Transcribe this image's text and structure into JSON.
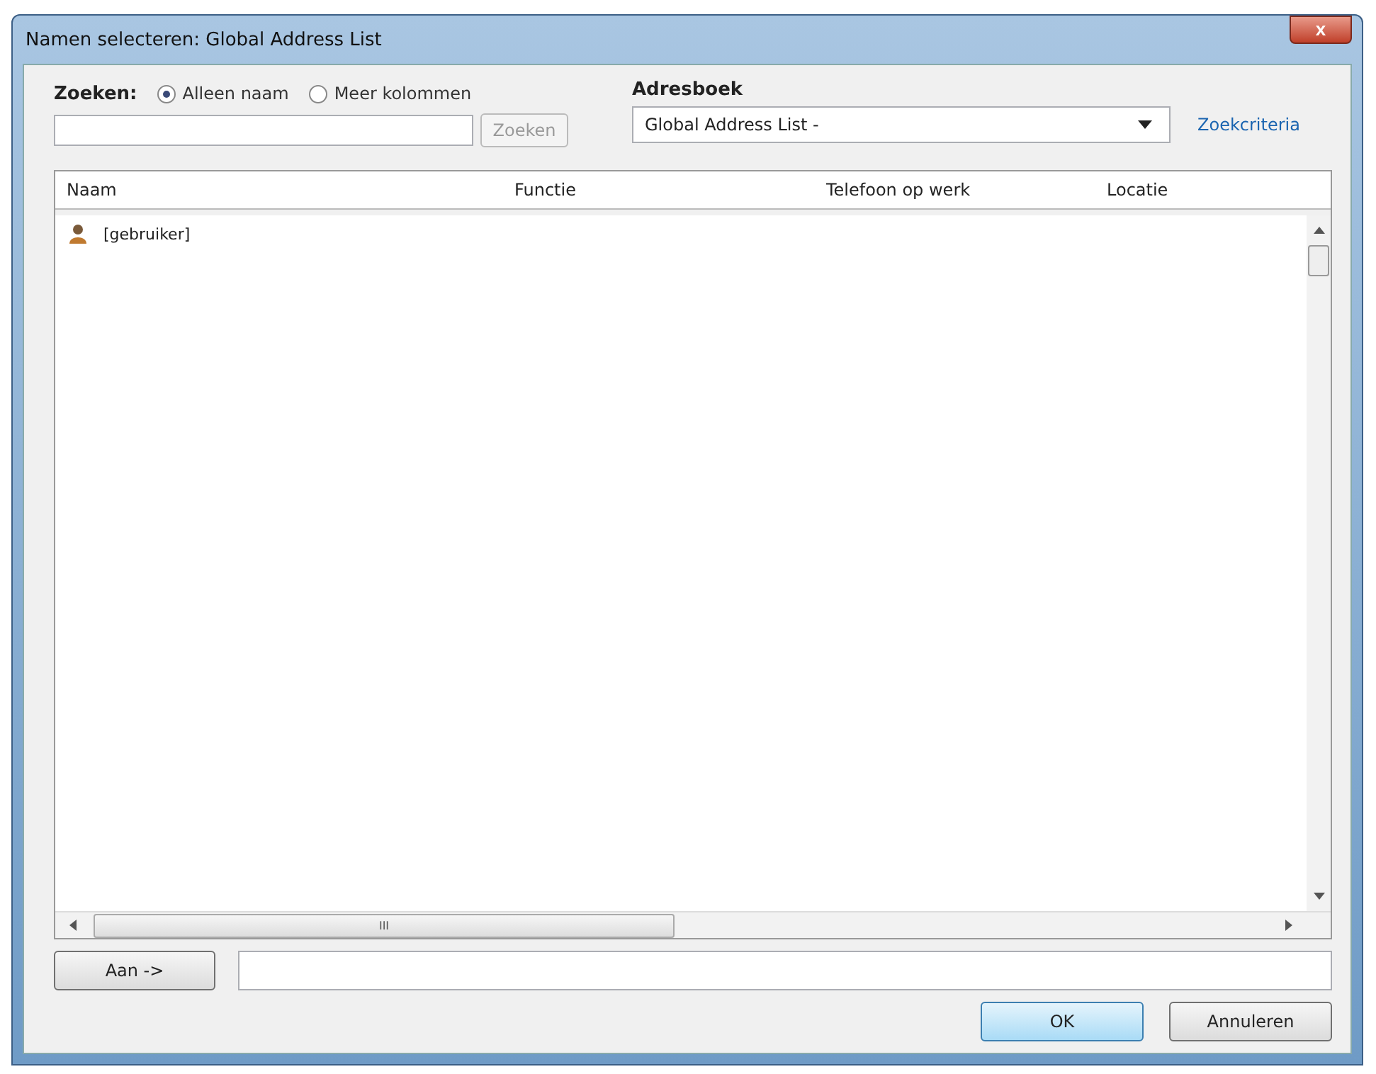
{
  "window": {
    "title": "Namen selecteren: Global Address List",
    "close": "x"
  },
  "search": {
    "label": "Zoeken:",
    "options": [
      {
        "label": "Alleen naam",
        "selected": true
      },
      {
        "label": "Meer kolommen",
        "selected": false
      }
    ],
    "button": "Zoeken",
    "disabled": true
  },
  "address_book": {
    "label": "Adresboek",
    "value": "Global Address List -",
    "link": "Zoekcriteria"
  },
  "table": {
    "columns": [
      "Naam",
      "Functie",
      "Telefoon op werk",
      "Locatie"
    ],
    "rows": [
      {
        "name": "[gebruiker]",
        "kind": "user"
      }
    ]
  },
  "horizontal_scroll_grip": "III",
  "to_button": "Aan ->",
  "buttons": [
    {
      "label": "OK",
      "default": true
    },
    {
      "label": "Annuleren",
      "default": false
    }
  ]
}
